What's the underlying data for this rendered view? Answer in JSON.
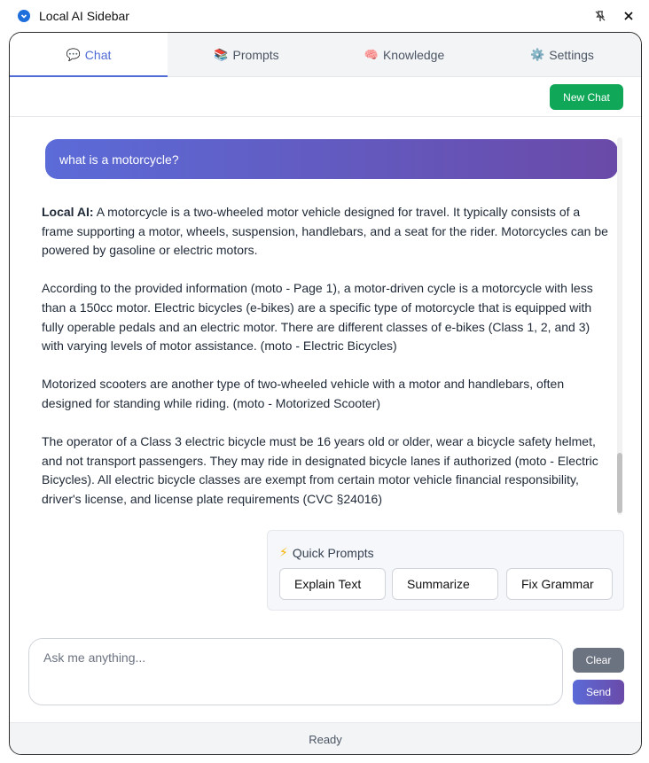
{
  "window": {
    "title": "Local AI Sidebar",
    "app_icon": "chrome-extension-icon",
    "pin_icon": "unpin-icon",
    "close_icon": "close-icon"
  },
  "tabs": [
    {
      "icon": "💬",
      "label": "Chat",
      "active": true
    },
    {
      "icon": "📚",
      "label": "Prompts",
      "active": false
    },
    {
      "icon": "🧠",
      "label": "Knowledge",
      "active": false
    },
    {
      "icon": "⚙️",
      "label": "Settings",
      "active": false
    }
  ],
  "toolbar": {
    "new_chat_label": "New Chat"
  },
  "conversation": {
    "user_message": "what is a motorcycle?",
    "ai_label": "Local AI:",
    "ai_paragraphs": [
      " A motorcycle is a two-wheeled motor vehicle designed for travel. It typically consists of a frame supporting a motor, wheels, suspension, handlebars, and a seat for the rider. Motorcycles can be powered by gasoline or electric motors.",
      "According to the provided information (moto - Page 1), a motor-driven cycle is a motorcycle with less than a 150cc motor. Electric bicycles (e-bikes) are a specific type of motorcycle that is equipped with fully operable pedals and an electric motor. There are different classes of e-bikes (Class 1, 2, and 3) with varying levels of motor assistance. (moto - Electric Bicycles)",
      "Motorized scooters are another type of two-wheeled vehicle with a motor and handlebars, often designed for standing while riding. (moto - Motorized Scooter)",
      "The operator of a Class 3 electric bicycle must be 16 years old or older, wear a bicycle safety helmet, and not transport passengers. They may ride in designated bicycle lanes if authorized (moto - Electric Bicycles). All electric bicycle classes are exempt from certain motor vehicle financial responsibility, driver's license, and license plate requirements (CVC §24016)"
    ]
  },
  "quick_prompts": {
    "icon": "⚡",
    "title": "Quick Prompts",
    "buttons": [
      "Explain Text",
      "Summarize",
      "Fix Grammar"
    ]
  },
  "input": {
    "placeholder": "Ask me anything...",
    "value": ""
  },
  "actions": {
    "clear_label": "Clear",
    "send_label": "Send"
  },
  "status": {
    "text": "Ready"
  },
  "colors": {
    "accent": "#4f6bd6",
    "new_chat": "#10a858",
    "gradient_start": "#5b6bd8",
    "gradient_end": "#6a4aa8"
  }
}
